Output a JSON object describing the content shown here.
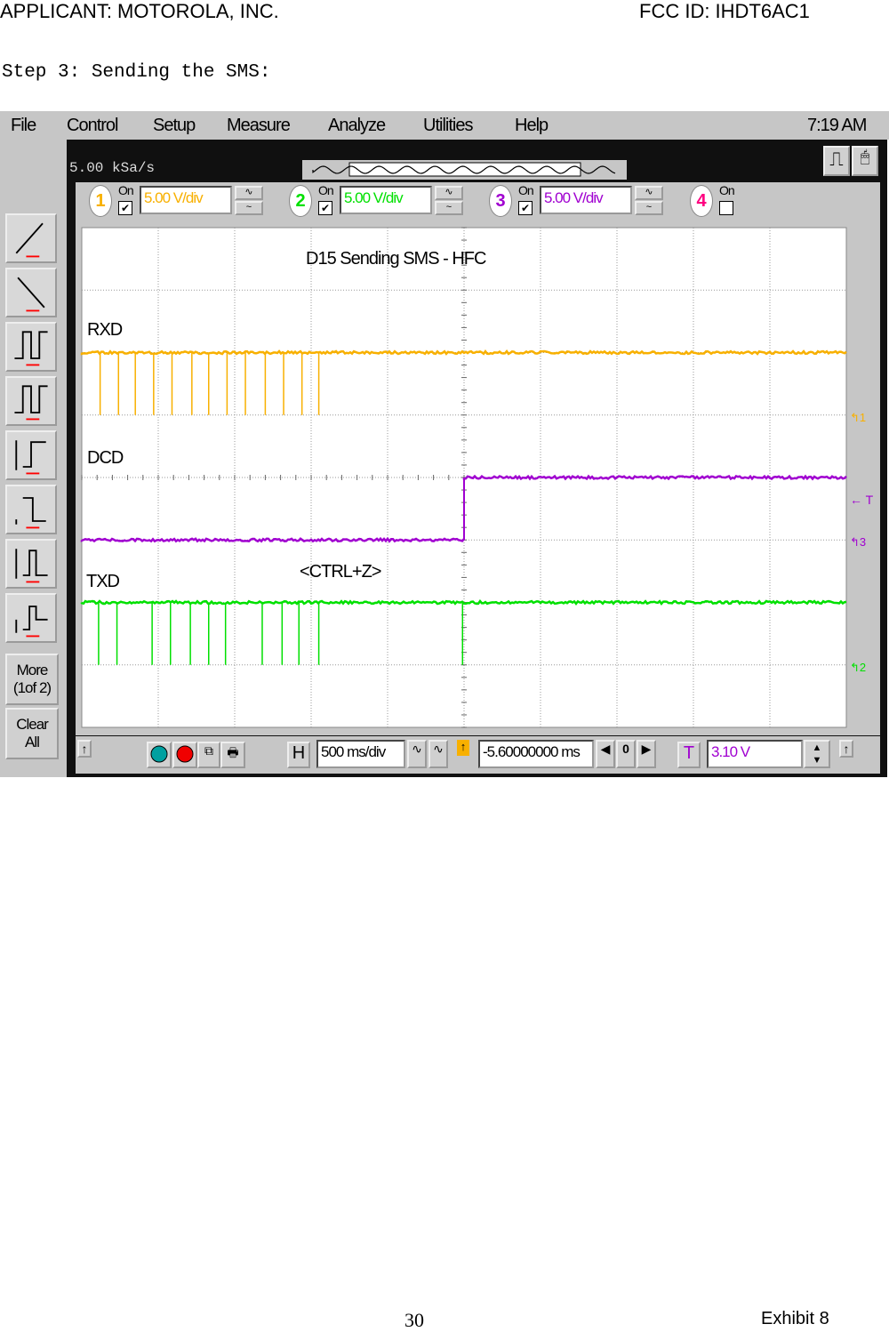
{
  "header": {
    "applicant": "APPLICANT:  MOTOROLA, INC.",
    "fcc_id": "FCC ID: IHDT6AC1"
  },
  "step_title": "Step 3: Sending the SMS:",
  "menu": {
    "items": [
      "File",
      "Control",
      "Setup",
      "Measure",
      "Analyze",
      "Utilities",
      "Help"
    ],
    "clock": "7:19 AM"
  },
  "scope": {
    "sample_rate": "5.00 kSa/s",
    "channels": [
      {
        "num": "1",
        "on_label": "On",
        "on": true,
        "scale": "5.00 V/div",
        "color": "#f8b000"
      },
      {
        "num": "2",
        "on_label": "On",
        "on": true,
        "scale": "5.00 V/div",
        "color": "#00e000"
      },
      {
        "num": "3",
        "on_label": "On",
        "on": true,
        "scale": "5.00 V/div",
        "color": "#a000d0"
      },
      {
        "num": "4",
        "on_label": "On",
        "on": false,
        "scale": "",
        "color": "#ff0080"
      }
    ],
    "left_toolbar": {
      "icons": [
        "rising-edge-icon",
        "falling-edge-icon",
        "pulse-width-icon",
        "pulse-period-icon",
        "rise-time-icon",
        "fall-time-icon",
        "amplitude-icon",
        "overshoot-icon"
      ],
      "more": "More",
      "more_page": "(1of 2)",
      "clear1": "Clear",
      "clear2": "All"
    },
    "plot": {
      "title": "D15 Sending SMS - HFC",
      "labels": {
        "rxd": "RXD",
        "dcd": "DCD",
        "txd": "TXD",
        "annotation": "<CTRL+Z>"
      },
      "markers": {
        "ch1": "1",
        "ch2": "2",
        "ch3": "3",
        "trigger": "T"
      }
    },
    "bottom": {
      "h_label": "H",
      "timebase": "500 ms/div",
      "delay": "-5.60000000 ms",
      "zero": "0",
      "t_label": "T",
      "trigger_level": "3.10 V"
    }
  },
  "chart_data": {
    "type": "line",
    "x_unit": "ms",
    "time_per_div_ms": 500,
    "divisions_x": 10,
    "divisions_y": 8,
    "grid": true,
    "series": [
      {
        "name": "RXD",
        "color": "#f8b000",
        "baseline": "high",
        "pulse_times_ms": [
          -2380,
          -2260,
          -2150,
          -2030,
          -1910,
          -1780,
          -1670,
          -1550,
          -1430,
          -1300,
          -1180,
          -1060,
          -950
        ]
      },
      {
        "name": "DCD",
        "color": "#a000d0",
        "low_before_ms": 0,
        "step": "low-to-high",
        "step_time_ms": 0
      },
      {
        "name": "TXD",
        "color": "#00e000",
        "baseline": "high",
        "pulse_times_ms": [
          -2390,
          -2270,
          -2040,
          -1920,
          -1790,
          -1670,
          -1560,
          -1320,
          -1190,
          -1080,
          -950,
          -10
        ]
      }
    ]
  },
  "footer": {
    "page": "30",
    "exhibit": "Exhibit 8"
  }
}
